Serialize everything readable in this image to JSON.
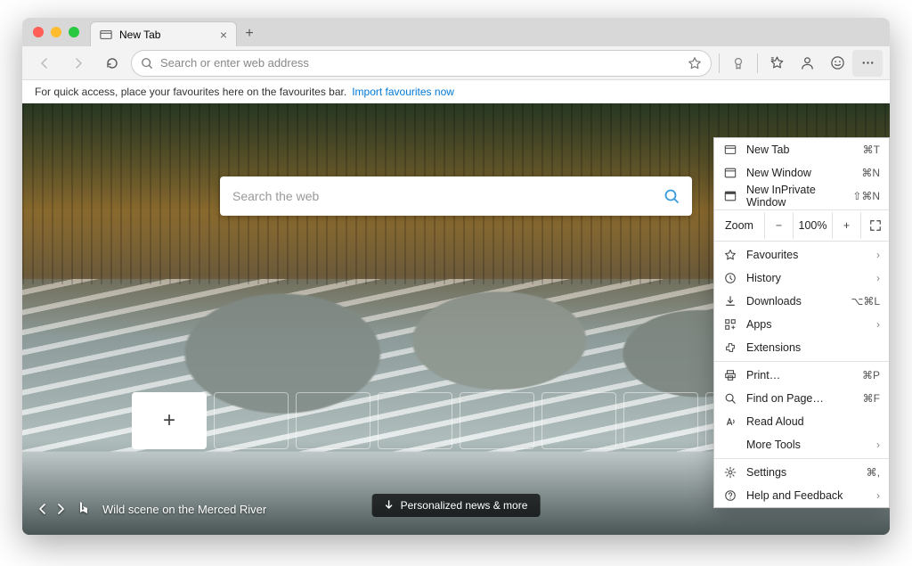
{
  "tab": {
    "title": "New Tab"
  },
  "omnibox": {
    "placeholder": "Search or enter web address"
  },
  "favbar": {
    "text": "For quick access, place your favourites here on the favourites bar.",
    "link": "Import favourites now"
  },
  "ntp": {
    "search_placeholder": "Search the web",
    "tile_count_empty": 7,
    "caption": "Wild scene on the Merced River",
    "news_label": "Personalized news & more"
  },
  "menu": {
    "new_tab": {
      "label": "New Tab",
      "shortcut": "⌘T"
    },
    "new_window": {
      "label": "New Window",
      "shortcut": "⌘N"
    },
    "inprivate": {
      "label": "New InPrivate Window",
      "shortcut": "⇧⌘N"
    },
    "zoom": {
      "label": "Zoom",
      "value": "100%"
    },
    "favourites": {
      "label": "Favourites"
    },
    "history": {
      "label": "History"
    },
    "downloads": {
      "label": "Downloads",
      "shortcut": "⌥⌘L"
    },
    "apps": {
      "label": "Apps"
    },
    "extensions": {
      "label": "Extensions"
    },
    "print": {
      "label": "Print…",
      "shortcut": "⌘P"
    },
    "find": {
      "label": "Find on Page…",
      "shortcut": "⌘F"
    },
    "read_aloud": {
      "label": "Read Aloud"
    },
    "more_tools": {
      "label": "More Tools"
    },
    "settings": {
      "label": "Settings",
      "shortcut": "⌘,"
    },
    "help": {
      "label": "Help and Feedback"
    }
  }
}
